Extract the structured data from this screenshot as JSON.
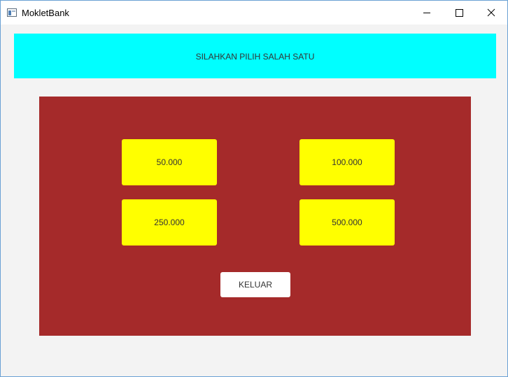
{
  "window": {
    "title": "MokletBank",
    "icon": "app-window-icon"
  },
  "banner": {
    "text": "SILAHKAN PILIH SALAH SATU",
    "color": "#00ffff"
  },
  "panel": {
    "color": "#a52a2a",
    "amounts": [
      {
        "label": "50.000"
      },
      {
        "label": "100.000"
      },
      {
        "label": "250.000"
      },
      {
        "label": "500.000"
      }
    ],
    "amount_button_color": "#ffff00",
    "exit_label": "KELUAR"
  }
}
